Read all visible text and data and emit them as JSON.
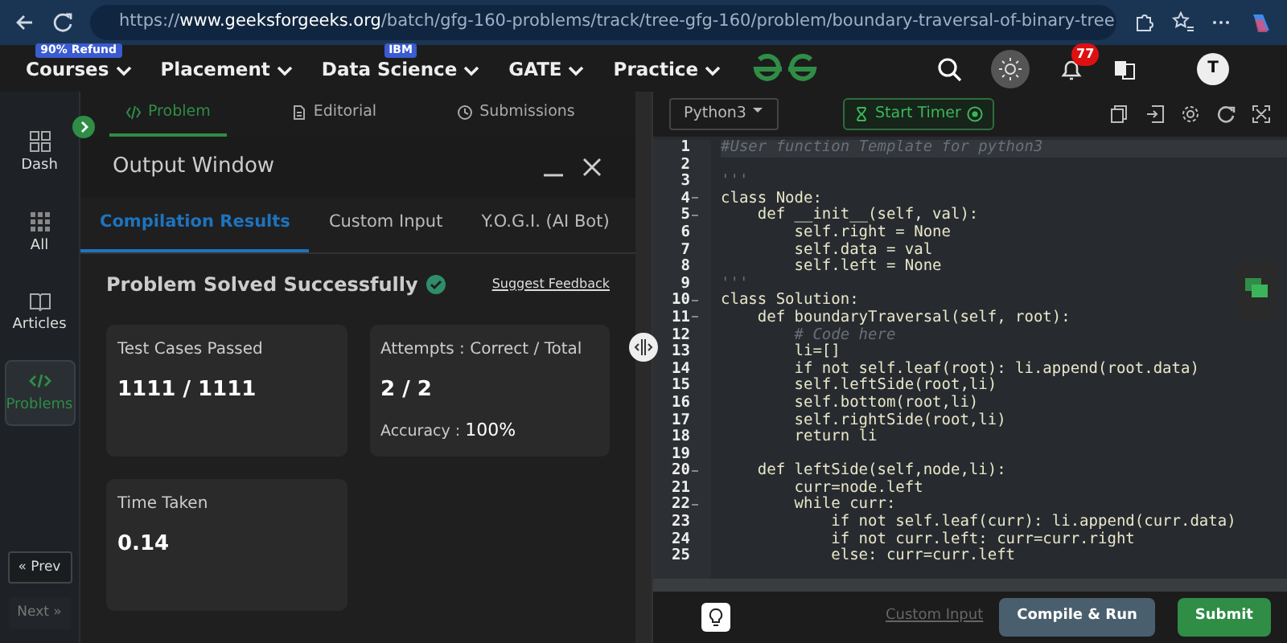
{
  "browser": {
    "url": "https://**www.geeksforgeeks.org**/batch/gfg-160-problems/track/tree-gfg-160/problem/boundary-traversal-of-binary-tree"
  },
  "nav": {
    "items": [
      {
        "label": "Courses",
        "tag": "90% Refund"
      },
      {
        "label": "Placement"
      },
      {
        "label": "Data Science",
        "tag": "IBM"
      },
      {
        "label": "GATE"
      },
      {
        "label": "Practice"
      }
    ],
    "notifications": "77",
    "avatar": "T"
  },
  "sidebar": {
    "items": [
      {
        "label": "Dash",
        "selected": false
      },
      {
        "label": "All",
        "selected": false
      },
      {
        "label": "Articles",
        "selected": false
      },
      {
        "label": "Problems",
        "selected": true
      }
    ],
    "prev": {
      "label": "« Prev",
      "disabled": false
    },
    "next": {
      "label": "Next »",
      "disabled": true
    }
  },
  "problem_tabs": [
    {
      "label": "Problem",
      "selected": true
    },
    {
      "label": "Editorial",
      "selected": false
    },
    {
      "label": "Submissions",
      "selected": false
    }
  ],
  "output_window": {
    "title": "Output Window",
    "tabs": [
      {
        "label": "Compilation Results",
        "selected": true
      },
      {
        "label": "Custom Input",
        "selected": false
      },
      {
        "label": "Y.O.G.I. (AI Bot)",
        "selected": false
      }
    ],
    "status": "Problem Solved Successfully",
    "feedback": "Suggest Feedback",
    "cards": [
      {
        "title": "Test Cases Passed",
        "value": "1111 / 1111"
      },
      {
        "title": "Attempts : Correct / Total",
        "value": "2 / 2",
        "extra_label": "Accuracy :",
        "extra_value": "100%"
      },
      {
        "title": "Time Taken",
        "value": "0.14"
      }
    ]
  },
  "editor": {
    "language": "Python3",
    "timer": "Start Timer",
    "lines": [
      {
        "number": "1",
        "text": "#User function Template for python3",
        "kind": "comment"
      },
      {
        "number": "2",
        "kind": "code"
      },
      {
        "number": "3",
        "text": "'''",
        "kind": "comment"
      },
      {
        "number": "4",
        "text": "class Node:",
        "kind": "code",
        "fold": true
      },
      {
        "number": "5",
        "text": "    def __init__(self, val):",
        "kind": "code",
        "fold": true
      },
      {
        "number": "6",
        "text": "        self.right = None",
        "kind": "code"
      },
      {
        "number": "7",
        "text": "        self.data = val",
        "kind": "code"
      },
      {
        "number": "8",
        "text": "        self.left = None",
        "kind": "code"
      },
      {
        "number": "9",
        "text": "'''",
        "kind": "comment"
      },
      {
        "number": "10",
        "text": "class Solution:",
        "kind": "code",
        "fold": true
      },
      {
        "number": "11",
        "text": "    def boundaryTraversal(self, root):",
        "kind": "code",
        "fold": true
      },
      {
        "number": "12",
        "text": "        # Code here",
        "kind": "comment"
      },
      {
        "number": "13",
        "text": "        li=[]",
        "kind": "code"
      },
      {
        "number": "14",
        "text": "        if not self.leaf(root): li.append(root.data)",
        "kind": "code"
      },
      {
        "number": "15",
        "text": "        self.leftSide(root,li)",
        "kind": "code"
      },
      {
        "number": "16",
        "text": "        self.bottom(root,li)",
        "kind": "code"
      },
      {
        "number": "17",
        "text": "        self.rightSide(root,li)",
        "kind": "code"
      },
      {
        "number": "18",
        "text": "        return li",
        "kind": "code"
      },
      {
        "number": "19",
        "kind": "code"
      },
      {
        "number": "20",
        "text": "    def leftSide(self,node,li):",
        "kind": "code",
        "fold": true
      },
      {
        "number": "21",
        "text": "        curr=node.left",
        "kind": "code"
      },
      {
        "number": "22",
        "text": "        while curr:",
        "kind": "code",
        "fold": true
      },
      {
        "number": "23",
        "text": "            if not self.leaf(curr): li.append(curr.data)",
        "kind": "code"
      },
      {
        "number": "24",
        "text": "            if not curr.left: curr=curr.right",
        "kind": "code"
      },
      {
        "number": "25",
        "text": "            else: curr=curr.left",
        "kind": "code"
      }
    ],
    "custom_input": "Custom Input",
    "compile": "Compile & Run",
    "submit": "Submit"
  }
}
